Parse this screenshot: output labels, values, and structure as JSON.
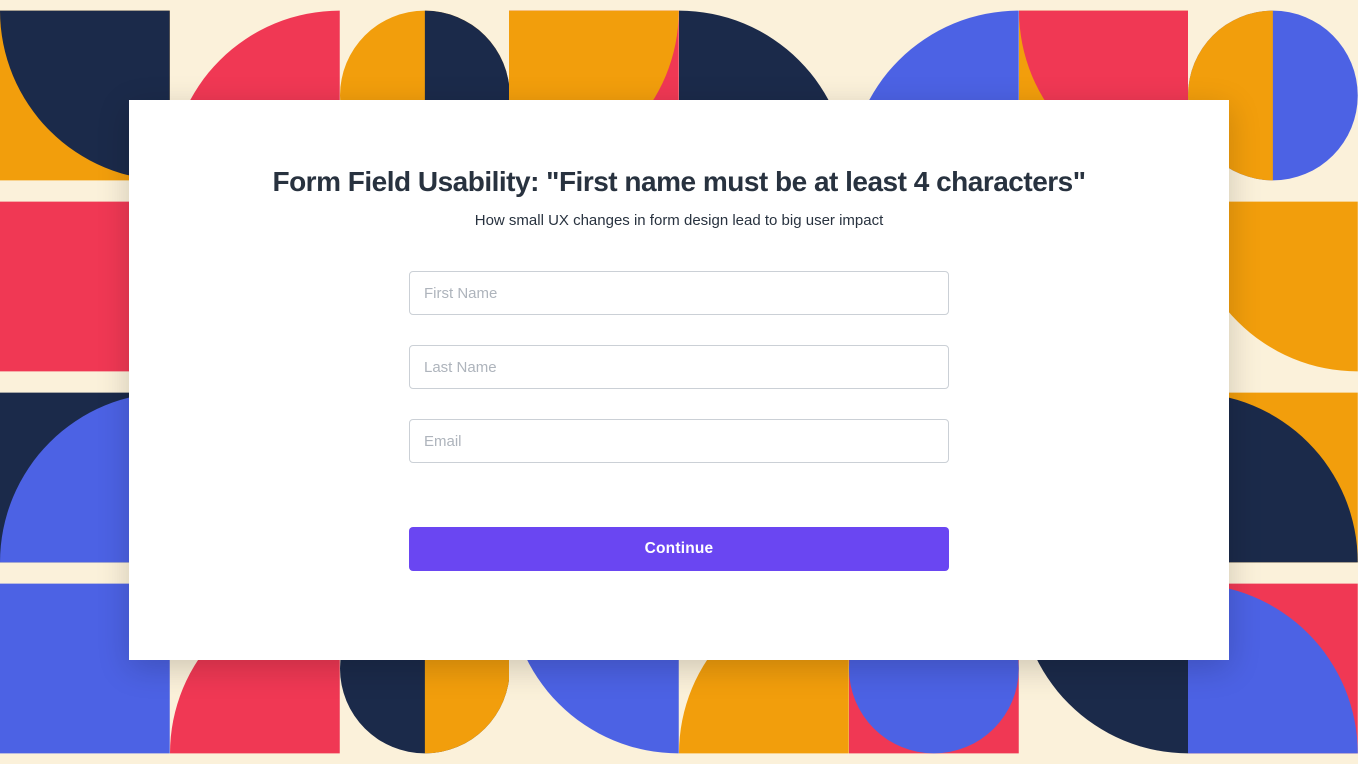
{
  "header": {
    "title": "Form Field Usability: \"First name must be at least 4 characters\"",
    "subtitle": "How small UX changes in form design lead to big user impact"
  },
  "form": {
    "first_name": {
      "placeholder": "First Name",
      "value": ""
    },
    "last_name": {
      "placeholder": "Last Name",
      "value": ""
    },
    "email": {
      "placeholder": "Email",
      "value": ""
    },
    "continue_label": "Continue"
  },
  "palette": {
    "orange": "#F29E0C",
    "red": "#F03854",
    "blue": "#4C62E4",
    "navy": "#1B2A4A",
    "cream": "#FBF1DA",
    "accent": "#6A46F2"
  }
}
